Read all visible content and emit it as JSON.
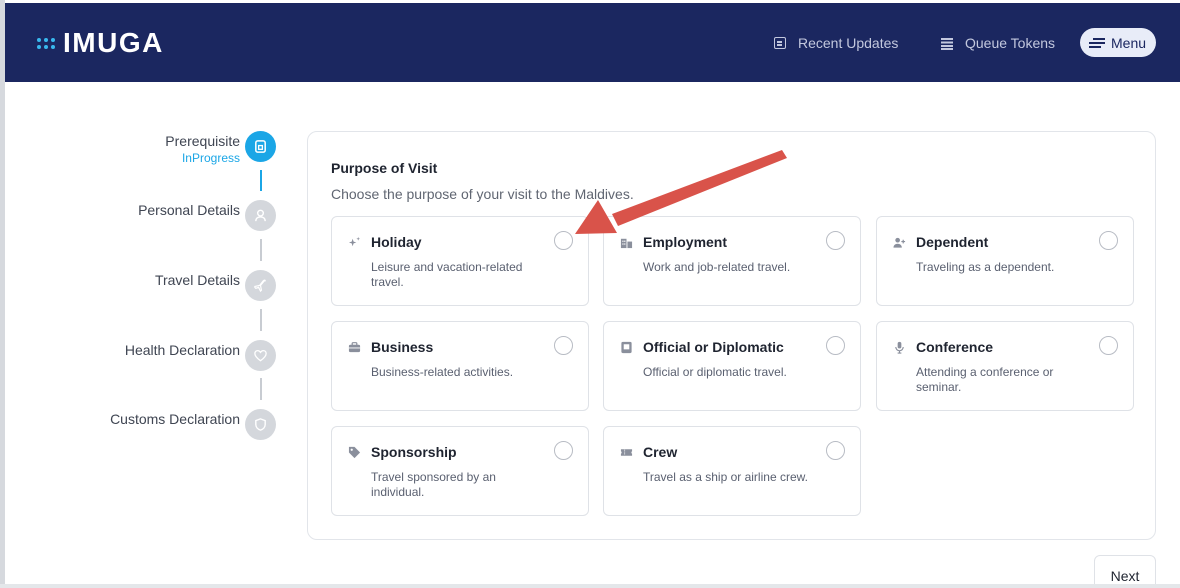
{
  "app": {
    "brand": "IMUGA"
  },
  "header": {
    "recent_updates": "Recent Updates",
    "queue_tokens": "Queue Tokens",
    "menu": "Menu"
  },
  "steps": [
    {
      "label": "Prerequisite",
      "status": "InProgress",
      "icon": "document-icon",
      "active": true
    },
    {
      "label": "Personal Details",
      "status": "",
      "icon": "person-icon",
      "active": false
    },
    {
      "label": "Travel Details",
      "status": "",
      "icon": "plane-icon",
      "active": false
    },
    {
      "label": "Health Declaration",
      "status": "",
      "icon": "heart-icon",
      "active": false
    },
    {
      "label": "Customs Declaration",
      "status": "",
      "icon": "shield-icon",
      "active": false
    }
  ],
  "form": {
    "title": "Purpose of Visit",
    "subtitle": "Choose the purpose of your visit to the Maldives.",
    "options": [
      {
        "title": "Holiday",
        "desc": "Leisure and vacation-related travel.",
        "icon": "sparkles-icon"
      },
      {
        "title": "Employment",
        "desc": "Work and job-related travel.",
        "icon": "building-icon"
      },
      {
        "title": "Dependent",
        "desc": "Traveling as a dependent.",
        "icon": "user-plus-icon"
      },
      {
        "title": "Business",
        "desc": "Business-related activities.",
        "icon": "briefcase-icon"
      },
      {
        "title": "Official or Diplomatic",
        "desc": "Official or diplomatic travel.",
        "icon": "badge-icon"
      },
      {
        "title": "Conference",
        "desc": "Attending a conference or seminar.",
        "icon": "microphone-icon"
      },
      {
        "title": "Sponsorship",
        "desc": "Travel sponsored by an individual.",
        "icon": "tag-icon"
      },
      {
        "title": "Crew",
        "desc": "Travel as a ship or airline crew.",
        "icon": "ticket-icon"
      }
    ],
    "next": "Next"
  },
  "colors": {
    "header": "#1b2760",
    "accent": "#1ba6e6",
    "annotation_arrow": "#d9534a"
  }
}
